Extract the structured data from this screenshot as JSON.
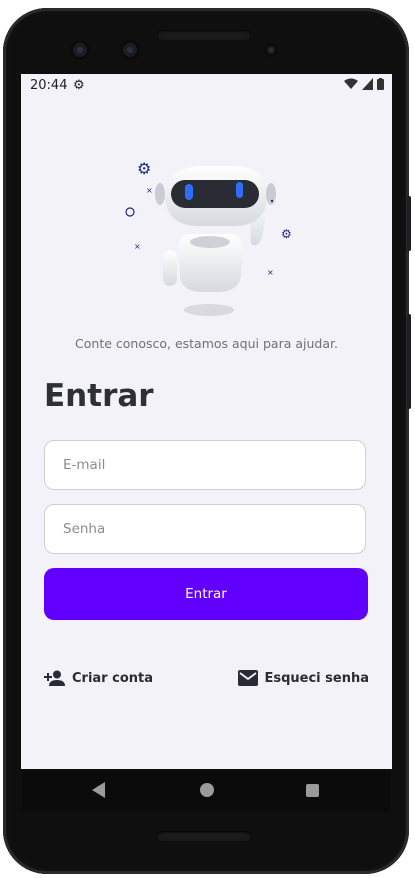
{
  "status": {
    "time": "20:44"
  },
  "tagline": "Conte conosco, estamos aqui para ajudar.",
  "login": {
    "title": "Entrar",
    "email_placeholder": "E-mail",
    "password_placeholder": "Senha",
    "submit_label": "Entrar"
  },
  "links": {
    "create_account": "Criar conta",
    "forgot_password": "Esqueci senha"
  },
  "colors": {
    "primary": "#6200ff",
    "background": "#f3f2f8",
    "accent_robot": "#1f2a86"
  },
  "icons": [
    "gear-icon",
    "wifi-icon",
    "signal-icon",
    "battery-icon",
    "add-person-icon",
    "mail-icon",
    "back-icon",
    "home-icon",
    "recent-apps-icon"
  ]
}
